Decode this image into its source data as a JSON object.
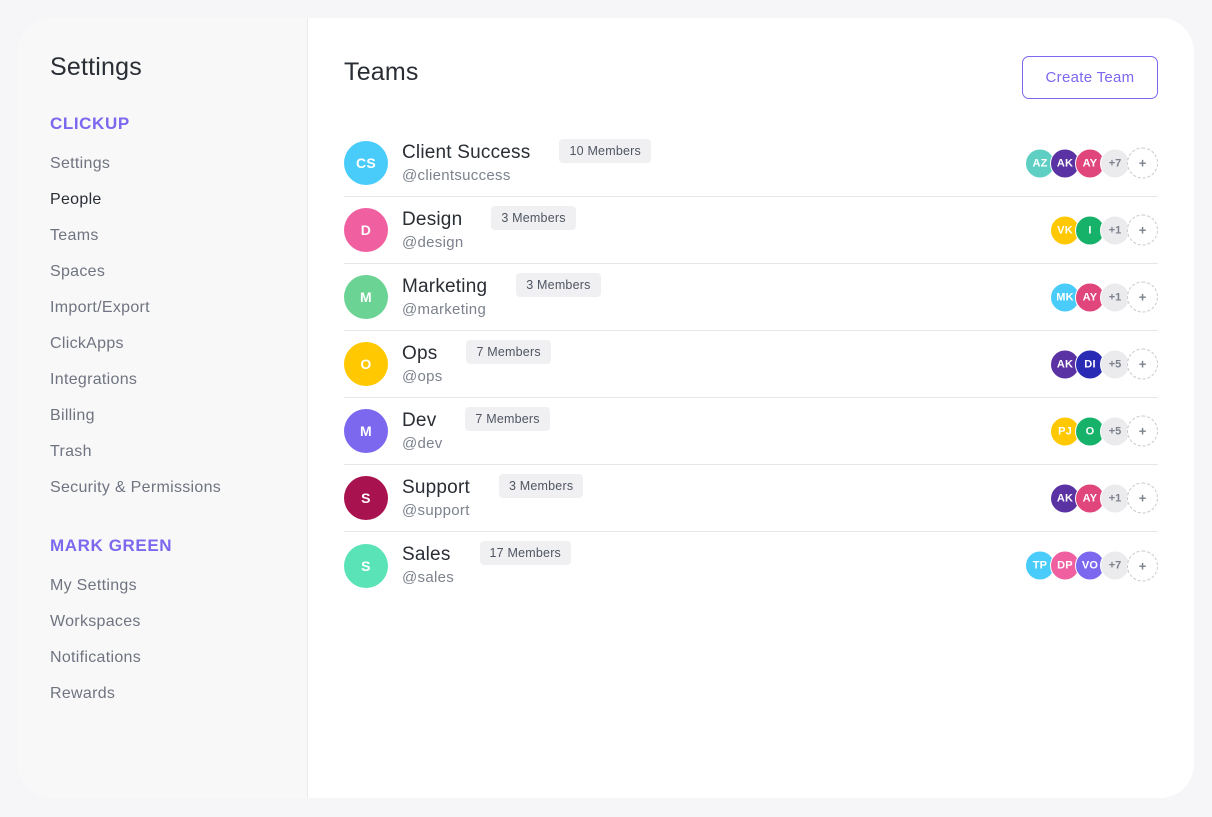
{
  "sidebar": {
    "title": "Settings",
    "sections": [
      {
        "header": "CLICKUP",
        "items": [
          {
            "label": "Settings",
            "active": false
          },
          {
            "label": "People",
            "active": true
          },
          {
            "label": "Teams",
            "active": false
          },
          {
            "label": "Spaces",
            "active": false
          },
          {
            "label": "Import/Export",
            "active": false
          },
          {
            "label": "ClickApps",
            "active": false
          },
          {
            "label": "Integrations",
            "active": false
          },
          {
            "label": "Billing",
            "active": false
          },
          {
            "label": "Trash",
            "active": false
          },
          {
            "label": "Security & Permissions",
            "active": false
          }
        ]
      },
      {
        "header": "MARK GREEN",
        "items": [
          {
            "label": "My Settings",
            "active": false
          },
          {
            "label": "Workspaces",
            "active": false
          },
          {
            "label": "Notifications",
            "active": false
          },
          {
            "label": "Rewards",
            "active": false
          }
        ]
      }
    ]
  },
  "main": {
    "title": "Teams",
    "create_button_label": "Create Team",
    "add_icon": "plus-icon",
    "add_label": "+",
    "teams": [
      {
        "initials": "CS",
        "color": "#49ccf9",
        "name": "Client Success",
        "members": "10 Members",
        "handle": "@clientsuccess",
        "avatars": [
          {
            "initials": "AZ",
            "color": "#5fcfc4"
          },
          {
            "initials": "AK",
            "color": "#5b32a3"
          },
          {
            "initials": "AY",
            "color": "#e0457b"
          }
        ],
        "more": "+7"
      },
      {
        "initials": "D",
        "color": "#f05fa0",
        "name": "Design",
        "members": "3 Members",
        "handle": "@design",
        "avatars": [
          {
            "initials": "VK",
            "color": "#ffc800"
          },
          {
            "initials": "I",
            "color": "#17b26a"
          }
        ],
        "more": "+1"
      },
      {
        "initials": "M",
        "color": "#6bd394",
        "name": "Marketing",
        "members": "3 Members",
        "handle": "@marketing",
        "avatars": [
          {
            "initials": "MK",
            "color": "#49ccf9"
          },
          {
            "initials": "AY",
            "color": "#e0457b"
          }
        ],
        "more": "+1"
      },
      {
        "initials": "O",
        "color": "#ffc800",
        "name": "Ops",
        "members": "7 Members",
        "handle": "@ops",
        "avatars": [
          {
            "initials": "AK",
            "color": "#5b32a3"
          },
          {
            "initials": "DI",
            "color": "#2a2bb5"
          }
        ],
        "more": "+5"
      },
      {
        "initials": "M",
        "color": "#7b68ee",
        "name": "Dev",
        "members": "7 Members",
        "handle": "@dev",
        "avatars": [
          {
            "initials": "PJ",
            "color": "#ffc800"
          },
          {
            "initials": "O",
            "color": "#17b26a"
          }
        ],
        "more": "+5"
      },
      {
        "initials": "S",
        "color": "#a8124f",
        "name": "Support",
        "members": "3 Members",
        "handle": "@support",
        "avatars": [
          {
            "initials": "AK",
            "color": "#5b32a3"
          },
          {
            "initials": "AY",
            "color": "#e0457b"
          }
        ],
        "more": "+1"
      },
      {
        "initials": "S",
        "color": "#5be3b8",
        "name": "Sales",
        "members": "17 Members",
        "handle": "@sales",
        "avatars": [
          {
            "initials": "TP",
            "color": "#49ccf9"
          },
          {
            "initials": "DP",
            "color": "#f05fa0"
          },
          {
            "initials": "VO",
            "color": "#7b68ee"
          }
        ],
        "more": "+7"
      }
    ]
  }
}
